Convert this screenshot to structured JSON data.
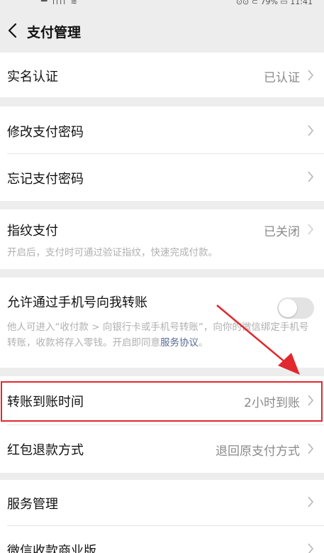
{
  "status_bar": {
    "left": "▀ ıllı ≋",
    "right": "⊙⊙ ⊂ 79% ▭ 11:41"
  },
  "header": {
    "title": "支付管理"
  },
  "rows": {
    "real_name": {
      "label": "实名认证",
      "value": "已认证"
    },
    "change_pw": {
      "label": "修改支付密码"
    },
    "forgot_pw": {
      "label": "忘记支付密码"
    },
    "fingerprint": {
      "label": "指纹支付",
      "value": "已关闭",
      "desc": "开启后，支付时可通过验证指纹，快速完成付款。"
    },
    "phone_transfer": {
      "label": "允许通过手机号向我转账",
      "toggle_on": false,
      "desc": "他人可进入“收付款 > 向银行卡或手机号转账”，向你的微信绑定手机号转账，收款将存入零钱。开启即同意",
      "link": "服务协议",
      "desc_end": "。"
    },
    "arrival_time": {
      "label": "转账到账时间",
      "value": "2小时到账"
    },
    "red_packet_refund": {
      "label": "红包退款方式",
      "value": "退回原支付方式"
    },
    "service_mgmt": {
      "label": "服务管理"
    },
    "merchant": {
      "label": "微信收款商业版"
    }
  },
  "colors": {
    "highlight": "#e0282e",
    "link": "#576b95",
    "background": "#ededed"
  }
}
